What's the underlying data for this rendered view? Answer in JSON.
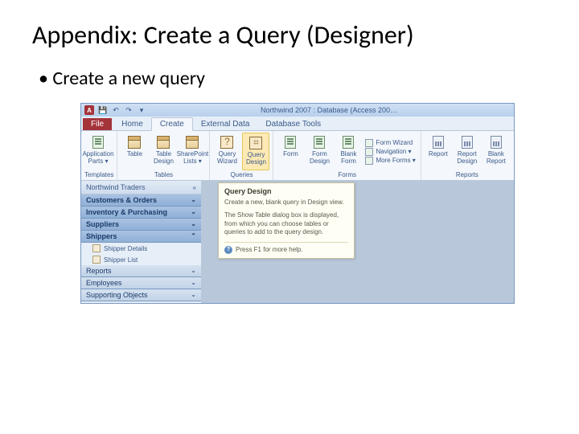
{
  "slide": {
    "title": "Appendix: Create a Query (Designer)",
    "bullet": "Create a new query"
  },
  "titlebar": {
    "app_letter": "A",
    "title": "Northwind 2007 : Database (Access 200…"
  },
  "tabs": {
    "file": "File",
    "home": "Home",
    "create": "Create",
    "external_data": "External Data",
    "database_tools": "Database Tools"
  },
  "ribbon": {
    "templates": {
      "app_parts": "Application Parts ▾",
      "label": "Templates"
    },
    "tables": {
      "table": "Table",
      "table_design": "Table Design",
      "sharepoint": "SharePoint Lists ▾",
      "label": "Tables"
    },
    "queries": {
      "wizard": "Query Wizard",
      "design": "Query Design",
      "label": "Queries"
    },
    "forms": {
      "form": "Form",
      "form_design": "Form Design",
      "blank": "Blank Form",
      "wizard": "Form Wizard",
      "nav": "Navigation ▾",
      "more": "More Forms ▾",
      "label": "Forms"
    },
    "reports": {
      "report": "Report",
      "design": "Report Design",
      "blank": "Blank Report",
      "label": "Reports"
    }
  },
  "nav": {
    "header": "Northwind Traders",
    "cats": [
      "Customers & Orders",
      "Inventory & Purchasing",
      "Suppliers",
      "Shippers"
    ],
    "items": [
      "Shipper Details",
      "Shipper List"
    ],
    "cats2": [
      "Reports",
      "Employees",
      "Supporting Objects"
    ]
  },
  "tooltip": {
    "title": "Query Design",
    "body1": "Create a new, blank query in Design view.",
    "body2": "The Show Table dialog box is displayed, from which you can choose tables or queries to add to the query design.",
    "help": "Press F1 for more help."
  }
}
